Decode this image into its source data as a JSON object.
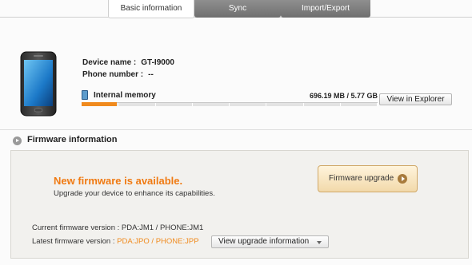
{
  "tabs": [
    {
      "label": "Basic information",
      "active": true
    },
    {
      "label": "Sync",
      "active": false
    },
    {
      "label": "Import/Export",
      "active": false
    }
  ],
  "device": {
    "name_label": "Device name :",
    "name_value": "GT-I9000",
    "phone_label": "Phone number :",
    "phone_value": "--",
    "image_icon": "smartphone-icon"
  },
  "memory": {
    "label": "Internal memory",
    "usage": "696.19 MB / 5.77 GB",
    "used_fraction": 0.118,
    "icon": "memory-card-icon",
    "fill_color": "#f08a1d"
  },
  "buttons": {
    "view_explorer": "View in Explorer",
    "firmware_upgrade": "Firmware upgrade",
    "view_upgrade_info": "View upgrade information"
  },
  "firmware": {
    "section_title": "Firmware information",
    "headline": "New firmware is available.",
    "subtext": "Upgrade your device to enhance its capabilities.",
    "current_label": "Current firmware version :",
    "current_value": "PDA:JM1 / PHONE:JM1",
    "latest_label": "Latest firmware version :",
    "latest_value": "PDA:JPO / PHONE:JPP",
    "accent_color": "#f07a12"
  }
}
